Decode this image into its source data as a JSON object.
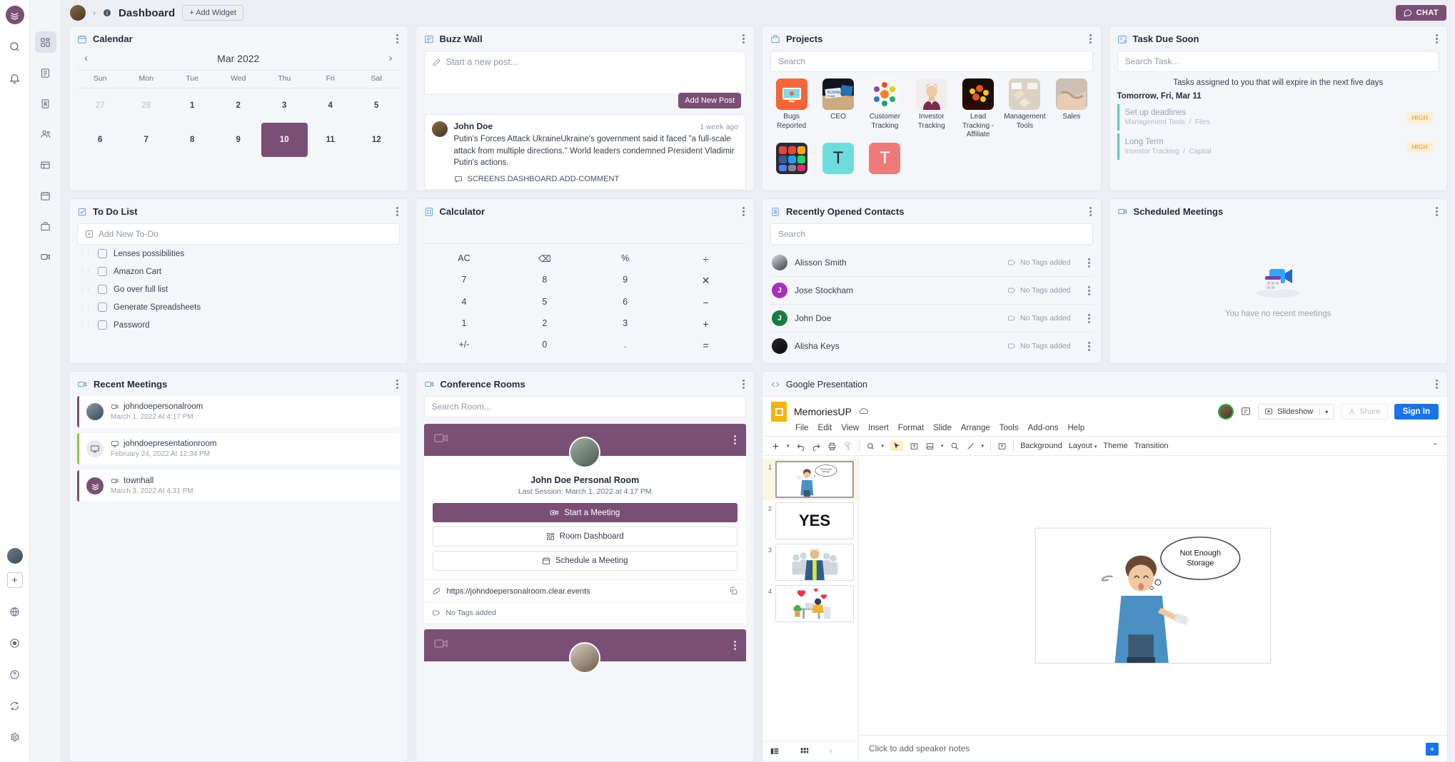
{
  "topbar": {
    "title": "Dashboard",
    "add_widget": "+ Add Widget",
    "chat": "CHAT",
    "info_icon": "info-icon",
    "chevron": "›"
  },
  "calendar": {
    "title": "Calendar",
    "month": "Mar 2022",
    "prev": "‹",
    "next": "›",
    "dow": [
      "Sun",
      "Mon",
      "Tue",
      "Wed",
      "Thu",
      "Fri",
      "Sat"
    ],
    "week1": [
      {
        "d": "27",
        "dim": true
      },
      {
        "d": "28",
        "dim": true
      },
      {
        "d": "1"
      },
      {
        "d": "2"
      },
      {
        "d": "3"
      },
      {
        "d": "4"
      },
      {
        "d": "5"
      }
    ],
    "week2": [
      {
        "d": "6"
      },
      {
        "d": "7"
      },
      {
        "d": "8"
      },
      {
        "d": "9"
      },
      {
        "d": "10",
        "selected": true
      },
      {
        "d": "11"
      },
      {
        "d": "12"
      }
    ],
    "selected_color": "#7a4f76"
  },
  "buzz_wall": {
    "title": "Buzz Wall",
    "composer_placeholder": "Start a new post...",
    "add_post_label": "Add New Post",
    "post": {
      "author": "John Doe",
      "time": "1 week ago",
      "text": "Putin's Forces Attack UkraineUkraine's government said it faced \"a full-scale attack from multiple directions.\" World leaders condemned President Vladimir Putin's actions.",
      "comment_label": "SCREENS.DASHBOARD.ADD-COMMENT"
    }
  },
  "projects": {
    "title": "Projects",
    "search_placeholder": "Search",
    "items": [
      {
        "label": "Bugs Reported",
        "thumb": "bugs",
        "color": "#f4663a"
      },
      {
        "label": "CEO",
        "thumb": "ceo",
        "color": "#12161f"
      },
      {
        "label": "Customer Tracking",
        "thumb": "customer",
        "color": "#f5f5f5"
      },
      {
        "label": "Investor Tracking",
        "thumb": "investor",
        "color": "#f0eeec"
      },
      {
        "label": "Lead Tracking - Affiliate",
        "thumb": "lead",
        "color": "#1a0d06"
      },
      {
        "label": "Management Tools",
        "thumb": "management",
        "color": "#d7cec4"
      },
      {
        "label": "Sales",
        "thumb": "sales",
        "color": "#cdbfb4"
      },
      {
        "label": "",
        "thumb": "social",
        "color": "#2b2b33"
      },
      {
        "label": "",
        "thumb": "letter-t-teal",
        "color": "#6fdcdc",
        "letter": "T"
      },
      {
        "label": "",
        "thumb": "letter-t-red",
        "color": "#ef7a7a",
        "letter": "T"
      }
    ]
  },
  "task_due": {
    "title": "Task Due Soon",
    "search_placeholder": "Search Task...",
    "note": "Tasks assigned to you that will expire in the next five days",
    "day_group": "Tomorrow, Fri, Mar 11",
    "tasks": [
      {
        "name": "Set up deadlines",
        "project": "Management Tools",
        "folder": "Files",
        "priority": "HIGH"
      },
      {
        "name": "Long Term",
        "project": "Investor Tracking",
        "folder": "Capital",
        "priority": "HIGH"
      }
    ],
    "priority_color": "#e2b15e",
    "accent_color": "#5fc4b8"
  },
  "todo": {
    "title": "To Do List",
    "add_placeholder": "Add New To-Do",
    "items": [
      "Lenses possibilities",
      "Amazon Cart",
      "Go over full list",
      "Generate Spreadsheets",
      "Password"
    ]
  },
  "calculator": {
    "title": "Calculator",
    "display": "",
    "rows": [
      [
        "AC",
        "⌫",
        "%",
        "÷"
      ],
      [
        "7",
        "8",
        "9",
        "✕"
      ],
      [
        "4",
        "5",
        "6",
        "−"
      ],
      [
        "1",
        "2",
        "3",
        "+"
      ],
      [
        "+/-",
        "0",
        ".",
        "="
      ]
    ]
  },
  "contacts": {
    "title": "Recently Opened Contacts",
    "search_placeholder": "Search",
    "tag_label": "No Tags added",
    "items": [
      {
        "name": "Alisson Smith",
        "initial": "A",
        "color": "#cfd3da",
        "photo": true
      },
      {
        "name": "Jose Stockham",
        "initial": "J",
        "color": "#a92fb8",
        "photo": false
      },
      {
        "name": "John Doe",
        "initial": "J",
        "color": "#1b7a45",
        "photo": false
      },
      {
        "name": "Alisha Keys",
        "initial": "A",
        "color": "#121212",
        "photo": true
      }
    ]
  },
  "scheduled_meetings": {
    "title": "Scheduled Meetings",
    "empty_text": "You have no recent meetings"
  },
  "recent_meetings": {
    "title": "Recent Meetings",
    "items": [
      {
        "name": "johndoepersonalroom",
        "date": "March 1, 2022 At 4:17 PM",
        "accent": "#7a4f76",
        "av": "photo"
      },
      {
        "name": "johndoepresentationroom",
        "date": "February 24, 2022 At 12:34 PM",
        "accent": "#8bc34a",
        "av": "screen"
      },
      {
        "name": "townhall",
        "date": "March 3, 2022 At 4:31 PM",
        "accent": "#7a4f76",
        "av": "logo"
      }
    ]
  },
  "conference_rooms": {
    "title": "Conference Rooms",
    "search_placeholder": "Search Room...",
    "room": {
      "name": "John Doe Personal Room",
      "last_session": "Last Session: March 1, 2022 at 4:17 PM",
      "start_label": "Start a Meeting",
      "dashboard_label": "Room Dashboard",
      "schedule_label": "Schedule a Meeting",
      "url": "https://johndoepersonalroom.clear.events",
      "tags": "No Tags added"
    },
    "banner_color": "#7a4f76"
  },
  "presentation": {
    "title": "Google Presentation",
    "doc_name": "MemoriesUP",
    "menu": [
      "File",
      "Edit",
      "View",
      "Insert",
      "Format",
      "Slide",
      "Arrange",
      "Tools",
      "Add-ons",
      "Help"
    ],
    "slideshow_label": "Slideshow",
    "share_label": "Share",
    "signin_label": "Sign In",
    "toolbar_text": [
      "Background",
      "Layout",
      "Theme",
      "Transition"
    ],
    "slides": [
      {
        "num": "1",
        "kind": "thought",
        "caption": "Not Enough Storage"
      },
      {
        "num": "2",
        "kind": "yes",
        "caption": "YES"
      },
      {
        "num": "3",
        "kind": "crowd",
        "caption": ""
      },
      {
        "num": "4",
        "kind": "hearts",
        "caption": ""
      }
    ],
    "current_slide_caption": "Not Enough Storage",
    "notes_placeholder": "Click to add speaker notes"
  },
  "rail_icons": [
    "app-logo-icon",
    "search-icon",
    "bell-icon"
  ],
  "nav_icons": [
    "dashboard-icon",
    "document-icon",
    "contacts-icon",
    "people-icon",
    "spreadsheet-icon",
    "calendar-icon",
    "projects-icon",
    "video-icon"
  ],
  "rail_bottom_icons": [
    "user-avatar",
    "add-icon",
    "globe-icon",
    "record-icon",
    "help-icon",
    "sync-icon",
    "settings-icon"
  ]
}
